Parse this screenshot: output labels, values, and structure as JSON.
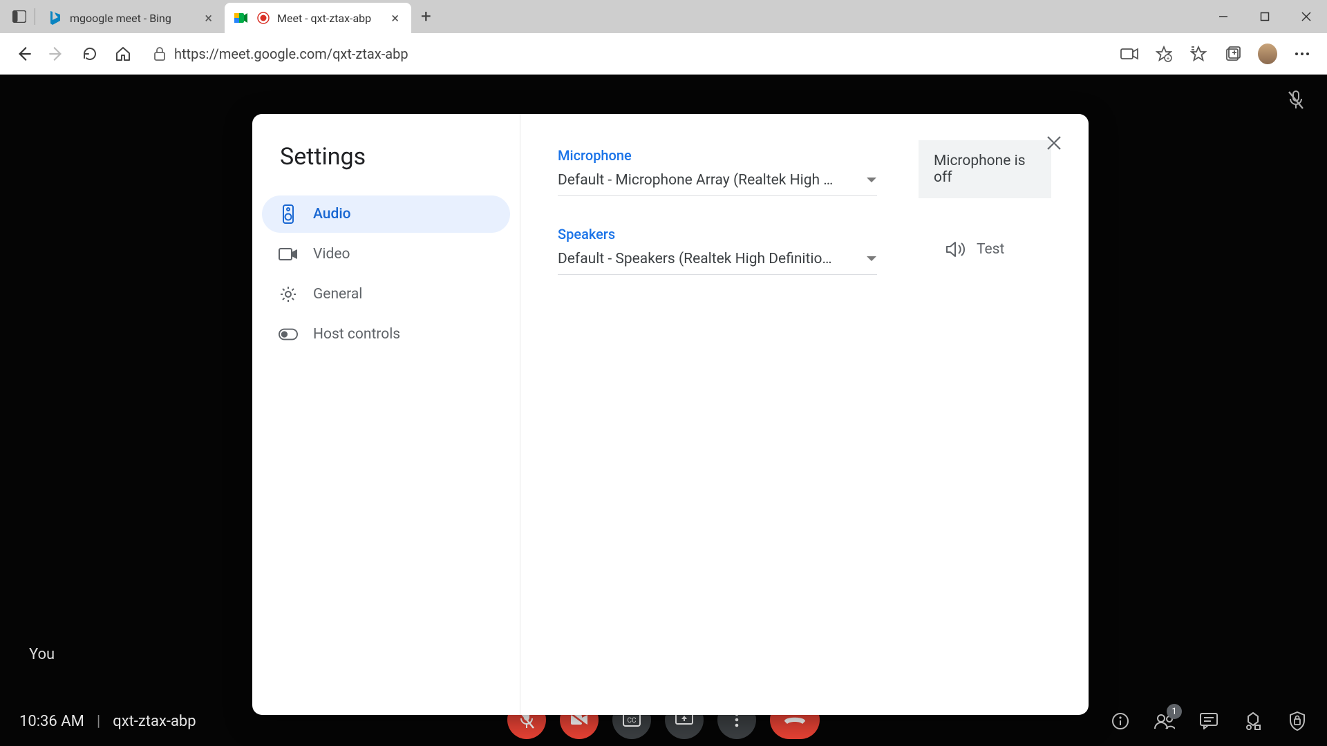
{
  "browser": {
    "tabs": [
      {
        "title": "mgoogle meet - Bing",
        "active": false
      },
      {
        "title": "Meet - qxt-ztax-abp",
        "active": true
      }
    ],
    "url": "https://meet.google.com/qxt-ztax-abp"
  },
  "meet": {
    "you_label": "You",
    "time": "10:36 AM",
    "meeting_id": "qxt-ztax-abp",
    "people_badge": "1"
  },
  "settings": {
    "title": "Settings",
    "nav": {
      "audio": "Audio",
      "video": "Video",
      "general": "General",
      "host_controls": "Host controls"
    },
    "microphone": {
      "label": "Microphone",
      "selected": "Default - Microphone Array (Realtek High …",
      "status": "Microphone is off"
    },
    "speakers": {
      "label": "Speakers",
      "selected": "Default - Speakers (Realtek High Definitio…",
      "test_label": "Test"
    }
  }
}
